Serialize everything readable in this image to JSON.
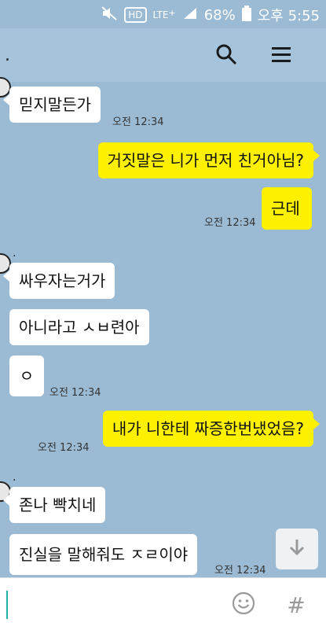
{
  "status": {
    "percent": "68%",
    "time": "오후 5:55",
    "hd": "HD",
    "lte": "LTE",
    "lte_sup": "+"
  },
  "header": {
    "title": "."
  },
  "messages": [
    {
      "sender": "",
      "text": "믿지말든가",
      "time": "오전 12:34"
    },
    {
      "text": "거짓말은 니가 먼저 친거아님?"
    },
    {
      "text": "근데",
      "time": "오전 12:34"
    },
    {
      "sender": ".",
      "text": "싸우자는거가"
    },
    {
      "text": "아니라고 ㅅㅂ련아"
    },
    {
      "text": "ㅇ",
      "time": "오전 12:34"
    },
    {
      "text": "내가 니한테 짜증한번냈었음?",
      "time": "오전 12:34"
    },
    {
      "sender": ".",
      "text": "존나 빡치네"
    },
    {
      "text": "진실을 말해줘도 ㅈㄹ이야",
      "time": "오전 12:34"
    }
  ],
  "input": {
    "hash": "#"
  }
}
